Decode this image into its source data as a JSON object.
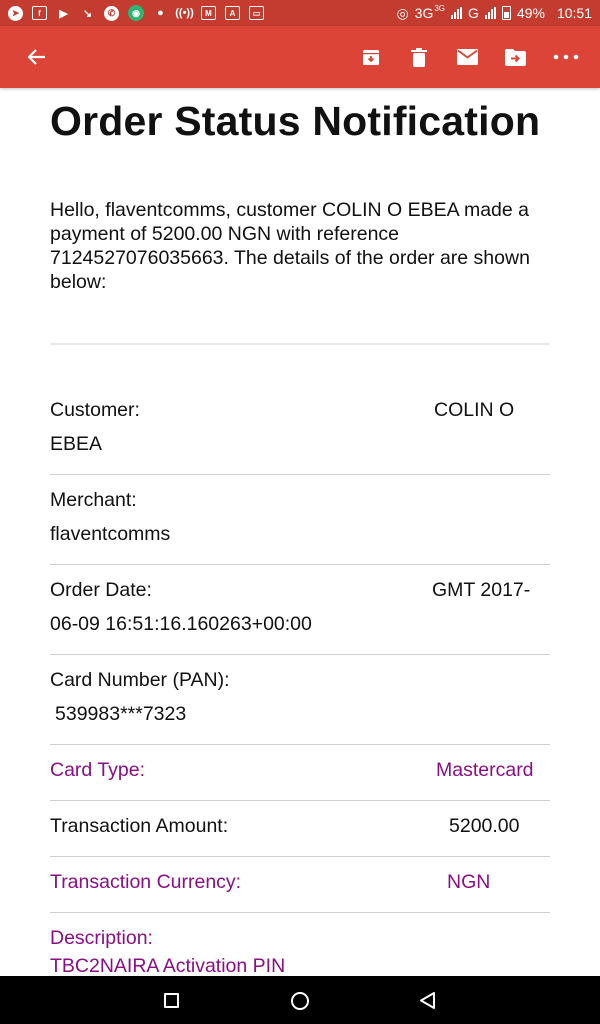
{
  "status_bar": {
    "network": "3G",
    "network_sup": "3G",
    "network2": "G",
    "battery": "49%",
    "time": "10:51"
  },
  "app_bar": {
    "back_icon": "arrow-back-icon",
    "actions": [
      "archive-icon",
      "delete-icon",
      "mark-unread-icon",
      "move-to-icon",
      "more-icon"
    ],
    "color": "#db4437"
  },
  "email": {
    "title": "Order Status Notification",
    "intro": "Hello, flaventcomms, customer COLIN O EBEA made a payment of 5200.00 NGN with reference 7124527076035663. The details of the order are shown below:",
    "details": {
      "customer_label": "Customer:",
      "customer_value": "COLIN O",
      "customer_value_cont": "EBEA",
      "merchant_label": "Merchant:",
      "merchant_value": "flaventcomms",
      "order_date_label": "Order Date:",
      "order_date_value": "GMT 2017-",
      "order_date_value_cont": "06-09 16:51:16.160263+00:00",
      "card_number_label": "Card Number (PAN):",
      "card_number_value": "539983***7323",
      "card_type_label": "Card Type:",
      "card_type_value": "Mastercard",
      "amount_label": "Transaction Amount:",
      "amount_value": "5200.00",
      "currency_label": "Transaction Currency:",
      "currency_value": "NGN",
      "description_label": "Description:",
      "description_value": "TBC2NAIRA Activation PIN"
    },
    "accent_color": "#8a0e86"
  },
  "nav_bar": {
    "buttons": [
      "recents-square-icon",
      "home-circle-icon",
      "back-triangle-icon"
    ]
  }
}
